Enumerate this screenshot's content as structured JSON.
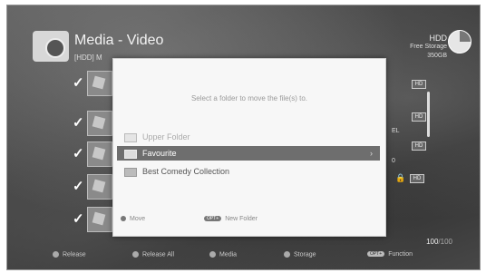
{
  "header": {
    "title": "Media - Video",
    "subtitle": "[HDD] M",
    "hdd_label": "HDD",
    "free_storage_label": "Free Storage",
    "free_storage_value": "350GB"
  },
  "list": {
    "rows": [
      {
        "checked": "✓"
      },
      {
        "checked": "✓"
      },
      {
        "checked": "✓"
      },
      {
        "checked": "✓"
      },
      {
        "checked": "✓"
      }
    ],
    "tags": [
      "HD",
      "HD",
      "HD",
      "HD"
    ],
    "side_text": [
      "EL",
      "0"
    ]
  },
  "counter": {
    "current": "100",
    "total": "/100"
  },
  "footer": {
    "release": "Release",
    "release_all": "Release All",
    "media": "Media",
    "storage": "Storage",
    "function_key": "OPT+",
    "function": "Function"
  },
  "dialog": {
    "prompt": "Select a folder to move the file(s) to.",
    "folders": [
      {
        "label": "Upper Folder",
        "state": "disabled"
      },
      {
        "label": "Favourite",
        "state": "selected"
      },
      {
        "label": "Best Comedy Collection",
        "state": "normal"
      }
    ],
    "selected_arrow": "›",
    "move_label": "Move",
    "new_folder_key": "OPT+",
    "new_folder_label": "New Folder"
  }
}
